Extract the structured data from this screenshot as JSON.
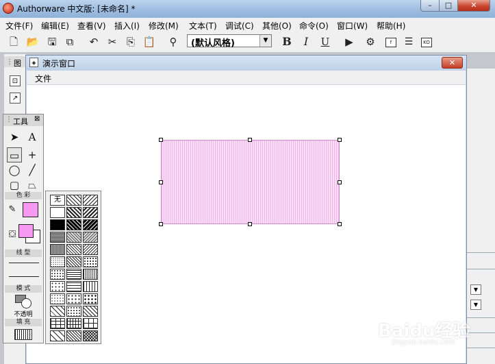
{
  "window": {
    "title": "Authorware 中文版: [未命名] *"
  },
  "menus": [
    "文件(F)",
    "编辑(E)",
    "查看(V)",
    "插入(I)",
    "修改(M)",
    "文本(T)",
    "调试(C)",
    "其他(O)",
    "命令(O)",
    "窗口(W)",
    "帮助(H)"
  ],
  "toolbar": {
    "icons": [
      "new-file-icon",
      "open-folder-icon",
      "save-all-icon",
      "import-icon",
      "undo-icon",
      "cut-icon",
      "copy-icon",
      "paste-icon",
      "find-icon"
    ],
    "style_select": "(默认风格)",
    "bold": "B",
    "italic": "I",
    "underline": "U",
    "icons2": [
      "run-icon",
      "control-panel-icon",
      "functions-icon",
      "variables-icon",
      "knowledge-objects-icon"
    ],
    "fx_label": "f",
    "ko_label": "KO"
  },
  "left_panel": {
    "title": "图"
  },
  "presentation": {
    "title": "演示窗口",
    "menu_file": "文件"
  },
  "tools_palette": {
    "title": "工具",
    "text_tool": "A",
    "color_label": "色 彩",
    "linetype_label": "线 型",
    "mode_label": "模 式",
    "mode_value": "不透明",
    "fill_label": "填 充"
  },
  "fill_patterns": {
    "none_label": "无",
    "rows": 12,
    "cols": 3
  },
  "colors": {
    "fill_pink": "#f59af0",
    "canvas": "#ffffff",
    "chrome": "#f0f0f0"
  },
  "watermark": {
    "text": "Baidu经验",
    "sub": "jingyan.baidu.com"
  }
}
